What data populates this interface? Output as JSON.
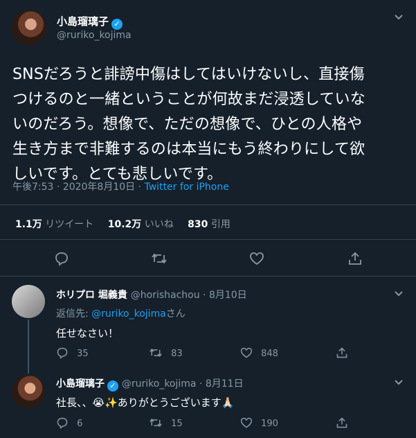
{
  "tweet": {
    "author": {
      "name": "小島瑠璃子",
      "handle": "@ruriko_kojima"
    },
    "text_lines": [
      "SNSだろうと誹謗中傷はしてはいけないし、直接傷",
      "つけるのと一緒ということが何故まだ浸透していな",
      "いのだろう。想像で、ただの想像で、ひとの人格や",
      "生き方まで非難するのは本当にもう終わりにして欲",
      "しいです。とても悲しいです。"
    ],
    "timestamp": "午後7:53 · 2020年8月10日 · ",
    "source": "Twitter for iPhone",
    "stats": {
      "retweets": "1.1万",
      "retweets_label": " リツイート",
      "likes": "10.2万",
      "likes_label": " いいね",
      "quotes": "830",
      "quotes_label": " 引用"
    }
  },
  "replies": [
    {
      "name": "ホリプロ 堀義貴",
      "handle": "@horishachou · 8月10日",
      "replying_label": "返信先: ",
      "replying_to": "@ruriko_kojima",
      "replying_suffix": "さん",
      "text": "任せなさい！",
      "counts": {
        "reply": "35",
        "retweet": "83",
        "like": "848"
      }
    },
    {
      "name": "小島瑠璃子",
      "handle": "@ruriko_kojima · 8月11日",
      "text": "社長、、😭✨ありがとうございます🙏🏻",
      "counts": {
        "reply": "6",
        "retweet": "15",
        "like": "190"
      }
    }
  ],
  "icons": {
    "verified": "verified-badge-icon",
    "chevron": "chevron-down-icon",
    "reply": "reply-icon",
    "retweet": "retweet-icon",
    "like": "heart-icon",
    "share": "share-icon"
  },
  "colors": {
    "background": "#15202b",
    "accent": "#1da1f2",
    "muted": "#8899a6",
    "divider": "#38444d"
  }
}
